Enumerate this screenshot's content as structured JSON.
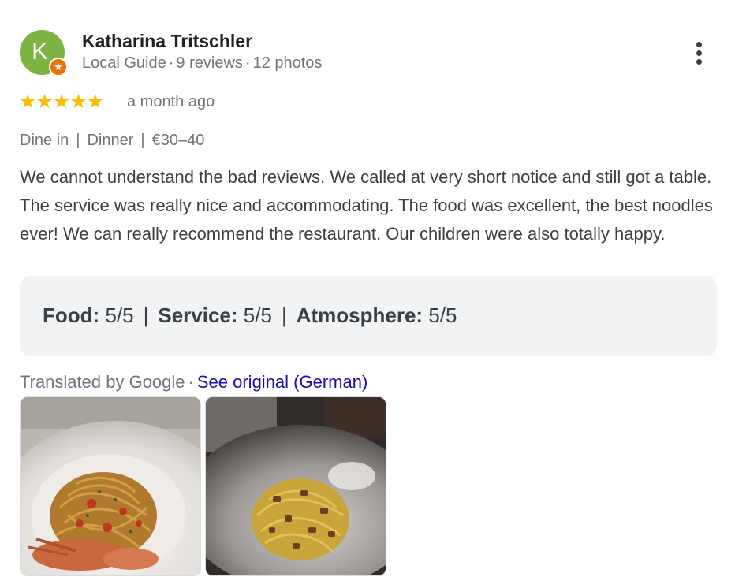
{
  "reviewer": {
    "avatar_letter": "K",
    "name": "Katharina Tritschler",
    "badge": "Local Guide",
    "reviews": "9 reviews",
    "photos": "12 photos",
    "meta_separator": "·"
  },
  "rating": {
    "stars": "★★★★★",
    "value": 5,
    "max": 5,
    "date": "a month ago"
  },
  "tags": [
    "Dine in",
    "Dinner",
    "€30–40"
  ],
  "tag_separator": "|",
  "review_text": "We cannot understand the bad reviews. We called at very short notice and still got a table. The service was really nice and accommodating. The food was excellent, the best noodles ever! We can really recommend the restaurant. Our children were also totally happy.",
  "sub_ratings": [
    {
      "label": "Food",
      "value": "5/5"
    },
    {
      "label": "Service",
      "value": "5/5"
    },
    {
      "label": "Atmosphere",
      "value": "5/5"
    }
  ],
  "translation": {
    "text": "Translated by Google",
    "separator": "·",
    "link": "See original (German)"
  },
  "colors": {
    "star": "#fbbc04",
    "avatar": "#7cb342",
    "badge": "#e8710a",
    "link": "#1a0dab",
    "ratings_bg": "#f1f3f4"
  },
  "icons": {
    "more": "more-vert-icon",
    "local_guide": "local-guide-star-icon"
  }
}
